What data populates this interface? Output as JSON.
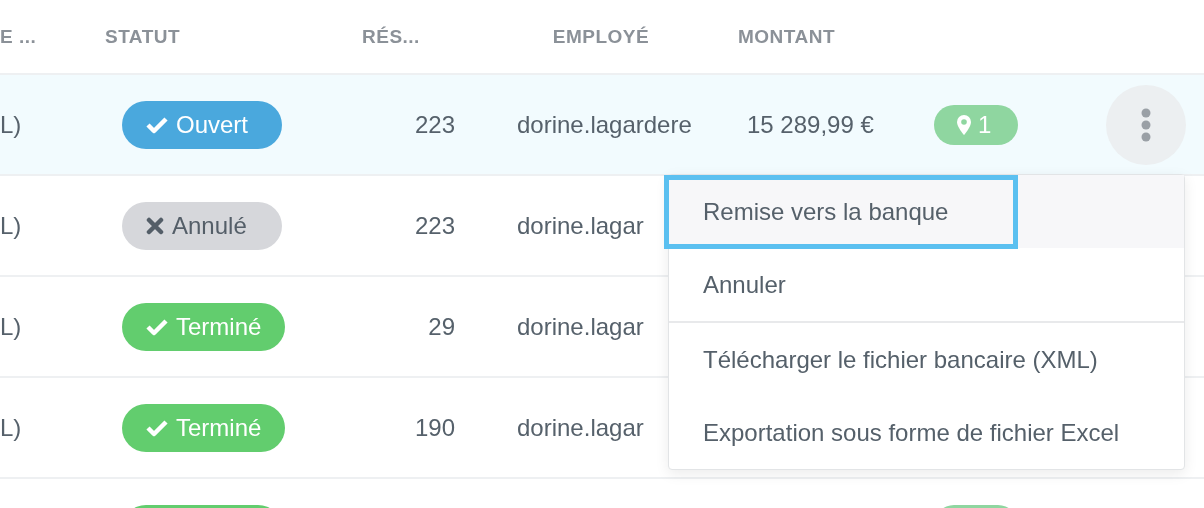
{
  "table": {
    "columns": [
      "E ...",
      "STATUT",
      "RÉS...",
      "EMPLOYÉ",
      "MONTANT"
    ],
    "rows": [
      {
        "selected": true,
        "column_1": "L)",
        "status": {
          "kind": "open",
          "label": "Ouvert"
        },
        "count": "223",
        "employee": "dorine.lagardere",
        "amount": "15 289,99 €",
        "has_pin": true,
        "pin_label": "1",
        "menu_open": true
      },
      {
        "selected": false,
        "column_1": "L)",
        "status": {
          "kind": "cancelled",
          "label": "Annulé"
        },
        "count": "223",
        "employee": "dorine.lagar"
      },
      {
        "selected": false,
        "column_1": "L)",
        "status": {
          "kind": "done",
          "label": "Terminé"
        },
        "count": "29",
        "employee": "dorine.lagar"
      },
      {
        "selected": false,
        "column_1": "L)",
        "status": {
          "kind": "done",
          "label": "Terminé"
        },
        "count": "190",
        "employee": "dorine.lagar"
      },
      {
        "selected": false,
        "status": {
          "kind": "done"
        },
        "has_pin": true
      }
    ]
  },
  "menu": {
    "items": [
      {
        "label": "Remise vers la banque",
        "highlighted": true,
        "divider_below": false
      },
      {
        "label": "Annuler",
        "highlighted": false,
        "divider_below": true
      },
      {
        "label": "Télécharger le fichier bancaire (XML)",
        "highlighted": false,
        "divider_below": false
      },
      {
        "label": "Exportation sous forme de fichier Excel",
        "highlighted": false,
        "divider_below": false
      }
    ]
  }
}
